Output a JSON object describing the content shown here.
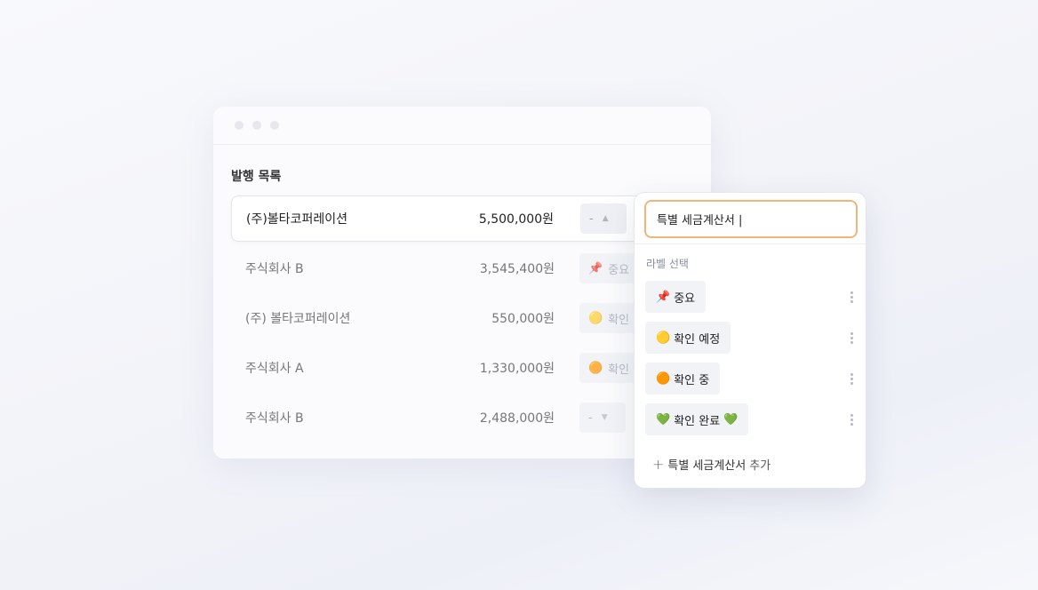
{
  "list": {
    "title": "발행 목록",
    "rows": [
      {
        "company": "(주)볼타코퍼레이션",
        "amount": "5,500,000원",
        "label": "-",
        "icon": "",
        "arrow": "▲"
      },
      {
        "company": "주식회사 B",
        "amount": "3,545,400원",
        "label": "중요",
        "icon": "📌",
        "arrow": ""
      },
      {
        "company": "(주) 볼타코퍼레이션",
        "amount": "550,000원",
        "label": "확인 예정",
        "icon": "🟡",
        "arrow": ""
      },
      {
        "company": "주식회사 A",
        "amount": "1,330,000원",
        "label": "확인 중",
        "icon": "🟠",
        "arrow": ""
      },
      {
        "company": "주식회사 B",
        "amount": "2,488,000원",
        "label": "-",
        "icon": "",
        "arrow": "▼"
      }
    ]
  },
  "dropdown": {
    "search_value": "특별 세금계산서 |",
    "heading": "라벨 선택",
    "labels": [
      {
        "icon": "📌",
        "text": "중요",
        "suffix": ""
      },
      {
        "icon": "🟡",
        "text": "확인 예정",
        "suffix": ""
      },
      {
        "icon": "🟠",
        "text": "확인 중",
        "suffix": ""
      },
      {
        "icon": "💚",
        "text": "확인 완료",
        "suffix": "💚"
      }
    ],
    "add_text": "특별 세금계산서",
    "add_suffix": "추가"
  },
  "colors": {
    "accent_border": "#f0b57a",
    "chip_bg": "#eef0f5"
  }
}
